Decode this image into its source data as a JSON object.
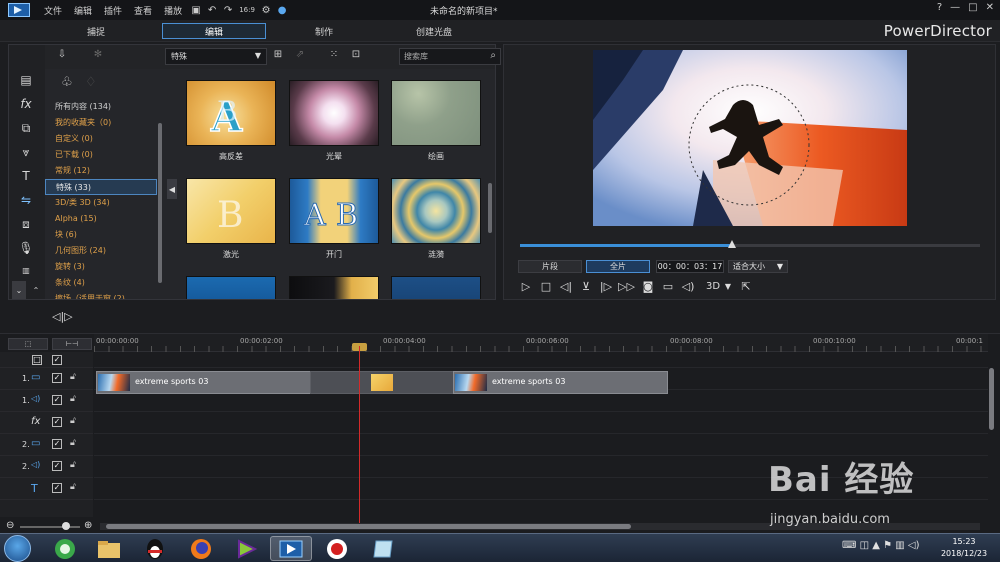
{
  "menubar": {
    "items": [
      "文件",
      "编辑",
      "插件",
      "查看",
      "播放"
    ],
    "title": "未命名的新项目*",
    "window_controls": [
      "?",
      "—",
      "□",
      "✕"
    ]
  },
  "modes": {
    "tabs": [
      "捕捉",
      "编辑",
      "制作",
      "创建光盘"
    ],
    "active": "编辑",
    "brand": "PowerDirector"
  },
  "library": {
    "category_selected": "特殊",
    "search_placeholder": "搜索库",
    "categories": [
      "所有内容 (134)",
      "我的收藏夹（0)",
      "自定义 (0)",
      "已下载 (0)",
      "常规 (12)",
      "特殊 (33)",
      "3D/类 3D (34)",
      "Alpha (15)",
      "块 (6)",
      "几何图形 (24)",
      "旋转 (3)",
      "条纹 (4)",
      "擦场（适用于窗 (2)"
    ],
    "selected_index": 5,
    "thumbnails": [
      {
        "label": "高反差"
      },
      {
        "label": "光晕"
      },
      {
        "label": "绘画"
      },
      {
        "label": "激光"
      },
      {
        "label": "开门"
      },
      {
        "label": "涟漪"
      },
      {
        "label": ""
      },
      {
        "label": ""
      },
      {
        "label": ""
      }
    ]
  },
  "preview": {
    "segment_btn": "片段",
    "full_btn": "全片",
    "timecode": "00：00：03：17",
    "fit": "适合大小",
    "progress": 0.46,
    "threed": "3D"
  },
  "timeline": {
    "head_btn_1": "⬚",
    "head_btn_2": "⊢⊣",
    "ruler": [
      "00:00:00:00",
      "00:00:02:00",
      "00:00:04:00",
      "00:00:06:00",
      "00:00:08:00",
      "00:00:10:00",
      "00:00:1"
    ],
    "tracks": [
      {
        "num": "",
        "icon": "□"
      },
      {
        "num": "1.",
        "icon": "▭"
      },
      {
        "num": "1.",
        "icon": "◁)"
      },
      {
        "num": "",
        "icon": "fx"
      },
      {
        "num": "2.",
        "icon": "▭"
      },
      {
        "num": "2.",
        "icon": "◁)"
      },
      {
        "num": "",
        "icon": "T"
      }
    ],
    "clips": [
      {
        "label": "extreme sports 03"
      },
      {
        "label": "extreme sports 03"
      }
    ]
  },
  "taskbar": {
    "time": "15:23",
    "date": "2018/12/23"
  },
  "watermark": {
    "brand": "Bai 经验",
    "url": "jingyan.baidu.com"
  }
}
